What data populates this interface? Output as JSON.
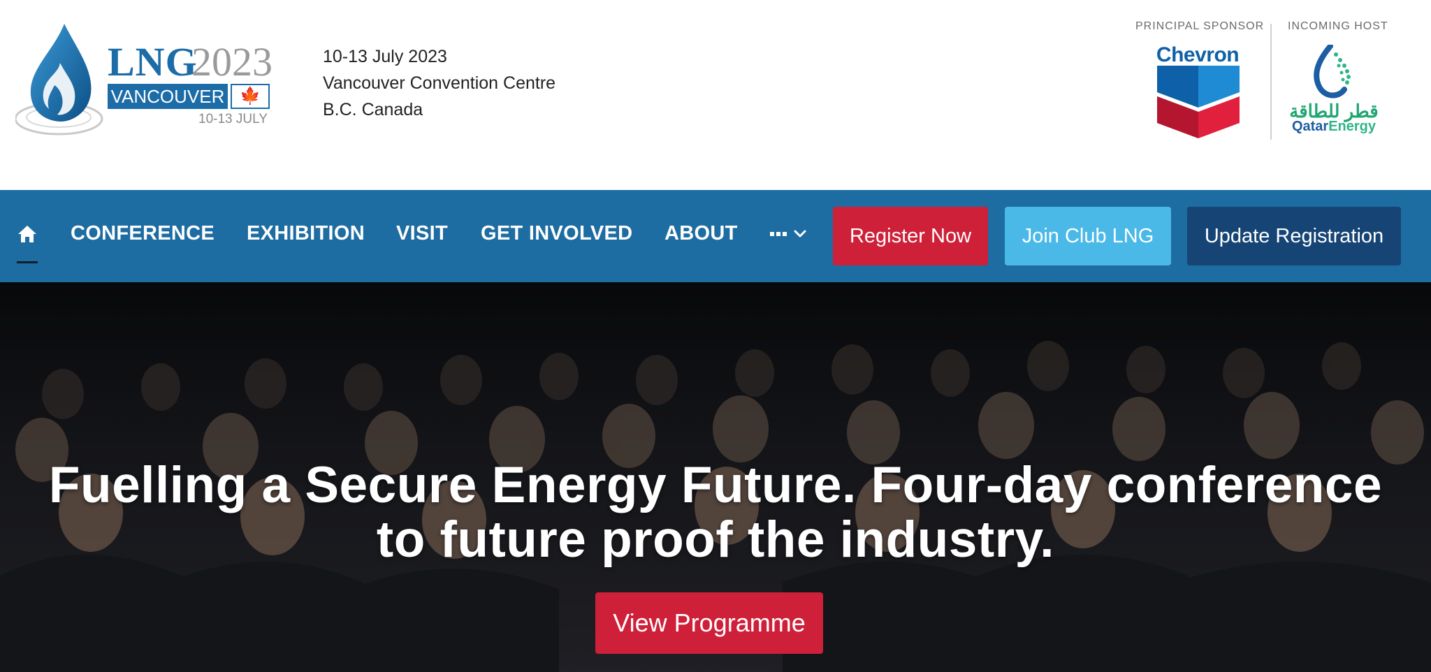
{
  "header": {
    "logo": {
      "brand": "LNG",
      "year": "2023",
      "city": "VANCOUVER",
      "dates": "10-13 JULY"
    },
    "event_info": {
      "date": "10-13 July 2023",
      "venue": "Vancouver Convention Centre",
      "location": "B.C. Canada"
    },
    "principal_sponsor": {
      "label": "PRINCIPAL SPONSOR",
      "name": "Chevron",
      "color": "#0e60a8"
    },
    "incoming_host": {
      "label": "INCOMING HOST",
      "name_ar": "قطر للطاقة",
      "name_part1": "Qatar",
      "name_part2": "Energy"
    }
  },
  "nav": {
    "home_icon": "home-icon",
    "items": [
      "CONFERENCE",
      "EXHIBITION",
      "VISIT",
      "GET INVOLVED",
      "ABOUT"
    ],
    "more_icon": "more-dots-icon",
    "buttons": {
      "register": "Register Now",
      "club": "Join Club LNG",
      "update": "Update Registration"
    }
  },
  "hero": {
    "title_line1": "Fuelling a Secure Energy Future. Four-day conference",
    "title_line2": "to future proof the industry.",
    "cta": "View Programme"
  },
  "colors": {
    "nav_bg": "#1d6ca2",
    "register": "#cf2039",
    "club": "#4ab9e8",
    "update": "#164575"
  }
}
